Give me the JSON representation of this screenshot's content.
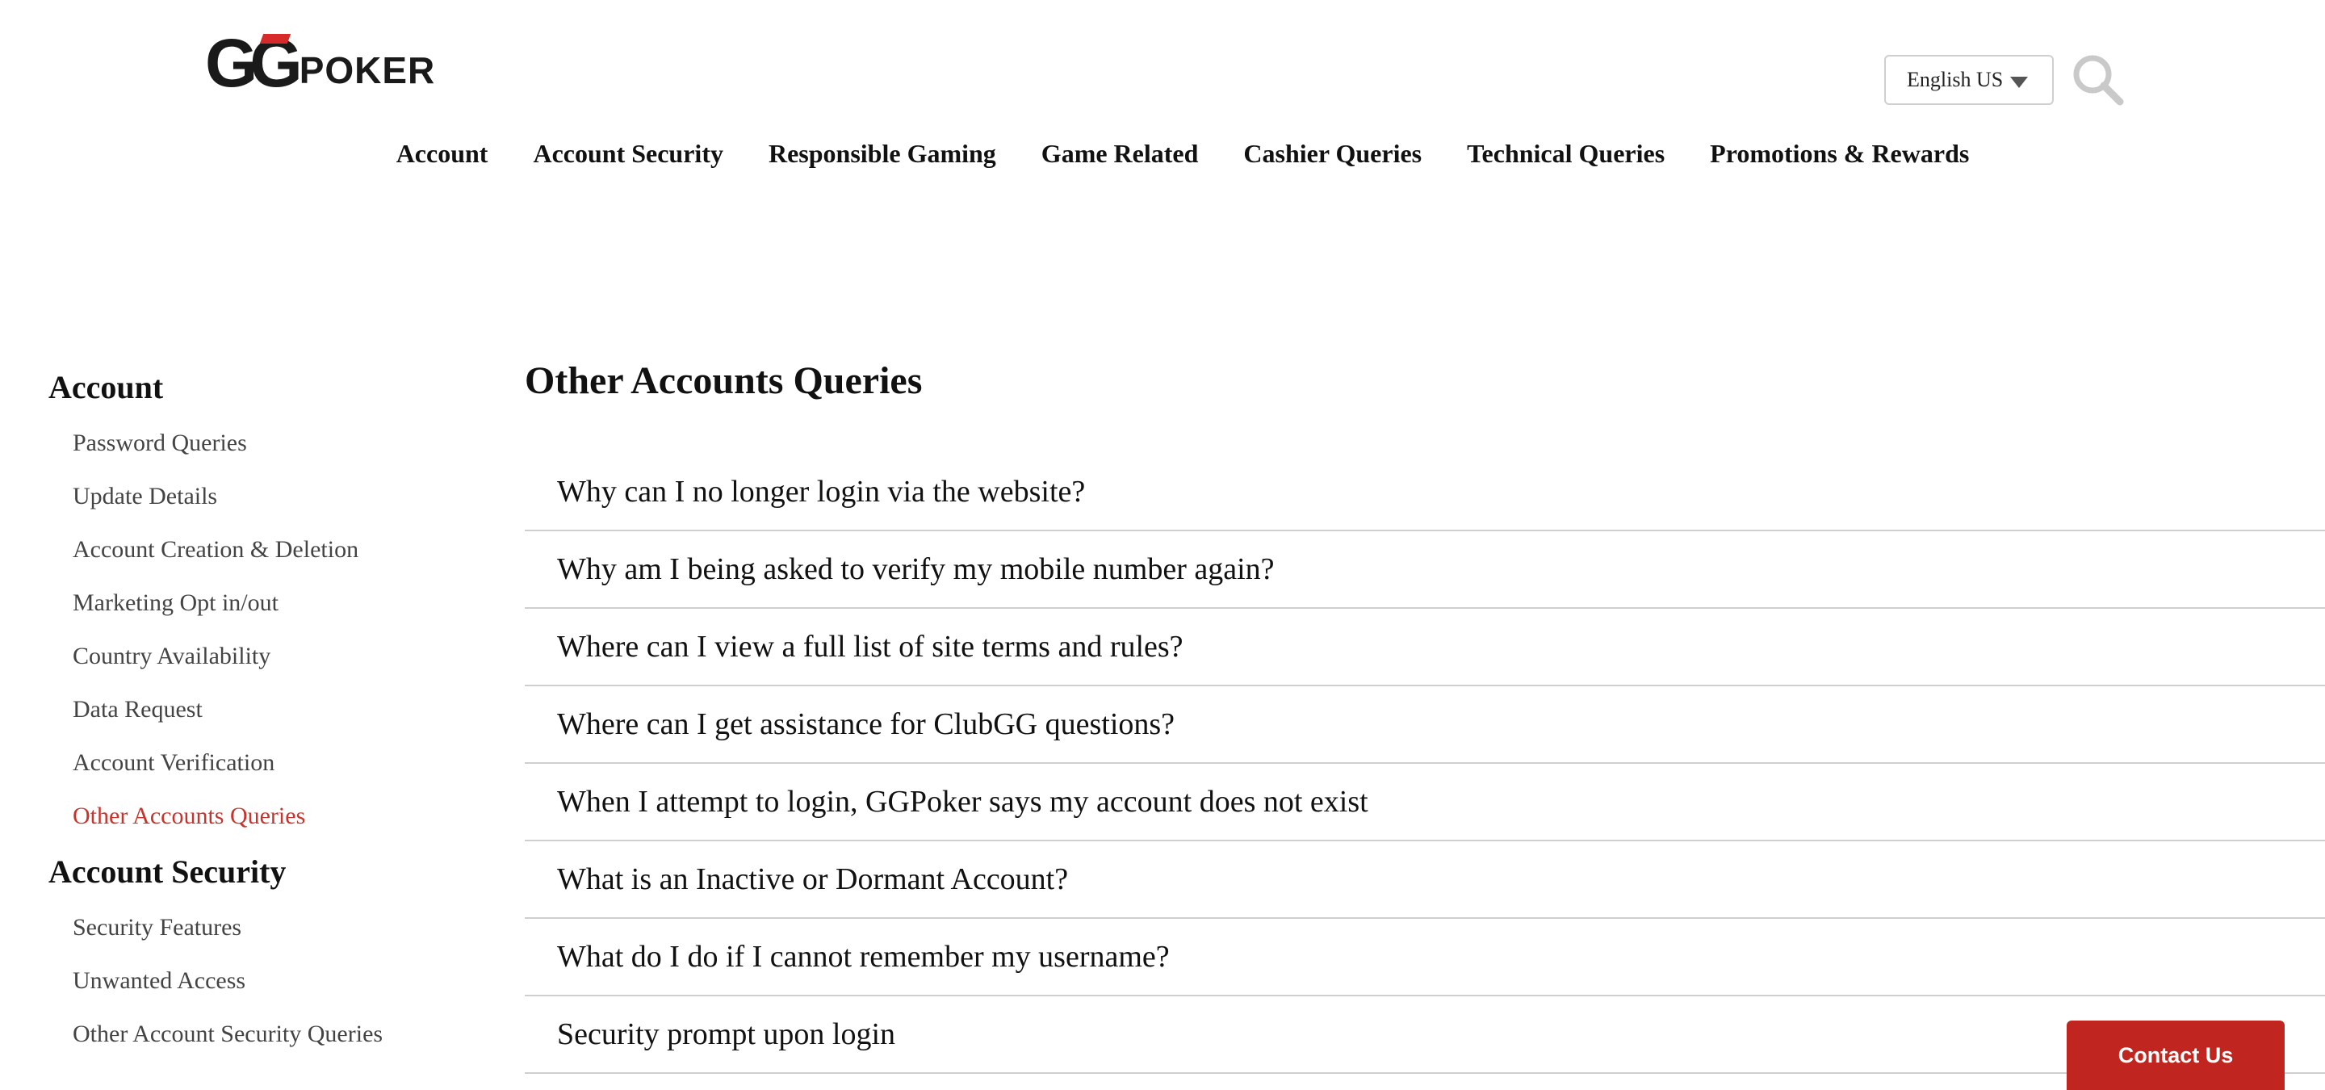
{
  "brand": {
    "logo_gg": "GG",
    "logo_poker": "POKER"
  },
  "header": {
    "language_value": "English US"
  },
  "nav": {
    "items": [
      {
        "label": "Account"
      },
      {
        "label": "Account Security"
      },
      {
        "label": "Responsible Gaming"
      },
      {
        "label": "Game Related"
      },
      {
        "label": "Cashier Queries"
      },
      {
        "label": "Technical Queries"
      },
      {
        "label": "Promotions & Rewards"
      }
    ]
  },
  "sidebar": {
    "sections": [
      {
        "heading": "Account",
        "links": [
          {
            "label": "Password Queries"
          },
          {
            "label": "Update Details"
          },
          {
            "label": "Account Creation & Deletion"
          },
          {
            "label": "Marketing Opt in/out"
          },
          {
            "label": "Country Availability"
          },
          {
            "label": "Data Request"
          },
          {
            "label": "Account Verification"
          },
          {
            "label": "Other Accounts Queries"
          }
        ]
      },
      {
        "heading": "Account Security",
        "links": [
          {
            "label": "Security Features"
          },
          {
            "label": "Unwanted Access"
          },
          {
            "label": "Other Account Security Queries"
          }
        ]
      }
    ]
  },
  "main": {
    "title": "Other Accounts Queries",
    "questions": [
      {
        "label": "Why can I no longer login via the website?"
      },
      {
        "label": "Why am I being asked to verify my mobile number again?"
      },
      {
        "label": "Where can I view a full list of site terms and rules?"
      },
      {
        "label": "Where can I get assistance for ClubGG questions?"
      },
      {
        "label": "When I attempt to login, GGPoker says my account does not exist"
      },
      {
        "label": "What is an Inactive or Dormant Account?"
      },
      {
        "label": "What do I do if I cannot remember my username?"
      },
      {
        "label": "Security prompt upon login"
      }
    ]
  },
  "contact": {
    "label": "Contact Us"
  },
  "colors": {
    "accent_red": "#c0261f",
    "active_link": "#c8342c"
  }
}
